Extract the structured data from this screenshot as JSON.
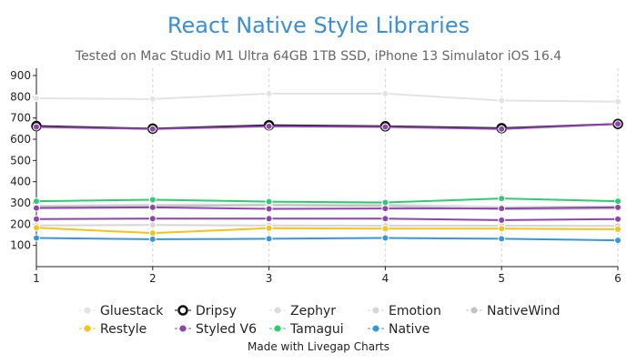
{
  "chart_data": {
    "type": "line",
    "title": "React Native Style Libraries",
    "subtitle": "Tested on Mac Studio M1 Ultra 64GB 1TB SSD, iPhone 13 Simulator iOS 16.4",
    "xlabel": "",
    "ylabel": "",
    "x": [
      1,
      2,
      3,
      4,
      5,
      6
    ],
    "xlim": [
      1,
      6
    ],
    "ylim": [
      0,
      900
    ],
    "yticks": [
      100,
      200,
      300,
      400,
      500,
      600,
      700,
      800,
      900
    ],
    "grid": {
      "vertical": true,
      "horizontal": false
    },
    "legend_position": "bottom",
    "series": [
      {
        "name": "Gluestack",
        "color": "#e3e3e3",
        "hollow": false,
        "values": [
          793,
          789,
          815,
          815,
          782,
          777
        ]
      },
      {
        "name": "Dripsy",
        "color": "#111111",
        "hollow": true,
        "values": [
          662,
          650,
          666,
          661,
          652,
          672
        ]
      },
      {
        "name": "Zephyr",
        "color": "#dcdcdc",
        "hollow": false,
        "values": [
          287,
          292,
          293,
          293,
          281,
          285
        ]
      },
      {
        "name": "Emotion",
        "color": "#d6d6d6",
        "hollow": false,
        "values": [
          194,
          196,
          194,
          193,
          193,
          192
        ]
      },
      {
        "name": "NativeWind",
        "color": "#c2c2c2",
        "hollow": false,
        "values": [
          283,
          285,
          290,
          286,
          270,
          273
        ]
      },
      {
        "name": "Restyle",
        "color": "#f2c318",
        "hollow": false,
        "values": [
          183,
          158,
          181,
          179,
          179,
          176
        ]
      },
      {
        "name": "Styled V6",
        "color": "#8e44ad",
        "hollow": false,
        "values": [
          658,
          648,
          661,
          658,
          648,
          672
        ]
      },
      {
        "name": "Styled V6",
        "color": "#8e44ad",
        "hollow": false,
        "values": [
          276,
          279,
          272,
          274,
          274,
          279
        ]
      },
      {
        "name": "Styled V6",
        "color": "#8e44ad",
        "hollow": false,
        "values": [
          224,
          226,
          226,
          226,
          219,
          224
        ]
      },
      {
        "name": "Tamagui",
        "color": "#2ecc71",
        "hollow": false,
        "values": [
          308,
          315,
          306,
          302,
          321,
          308
        ]
      },
      {
        "name": "Native",
        "color": "#3498db",
        "hollow": false,
        "values": [
          135,
          129,
          131,
          135,
          131,
          124
        ]
      }
    ],
    "legend": [
      {
        "name": "Gluestack",
        "color": "#e3e3e3",
        "hollow": false
      },
      {
        "name": "Dripsy",
        "color": "#111111",
        "hollow": true
      },
      {
        "name": "Zephyr",
        "color": "#dcdcdc",
        "hollow": false
      },
      {
        "name": "Emotion",
        "color": "#d6d6d6",
        "hollow": false
      },
      {
        "name": "NativeWind",
        "color": "#c2c2c2",
        "hollow": false
      },
      {
        "name": "Restyle",
        "color": "#f2c318",
        "hollow": false
      },
      {
        "name": "Styled V6",
        "color": "#8e44ad",
        "hollow": false
      },
      {
        "name": "Tamagui",
        "color": "#2ecc71",
        "hollow": false
      },
      {
        "name": "Native",
        "color": "#3498db",
        "hollow": false
      }
    ],
    "credit": "Made with Livegap Charts"
  }
}
